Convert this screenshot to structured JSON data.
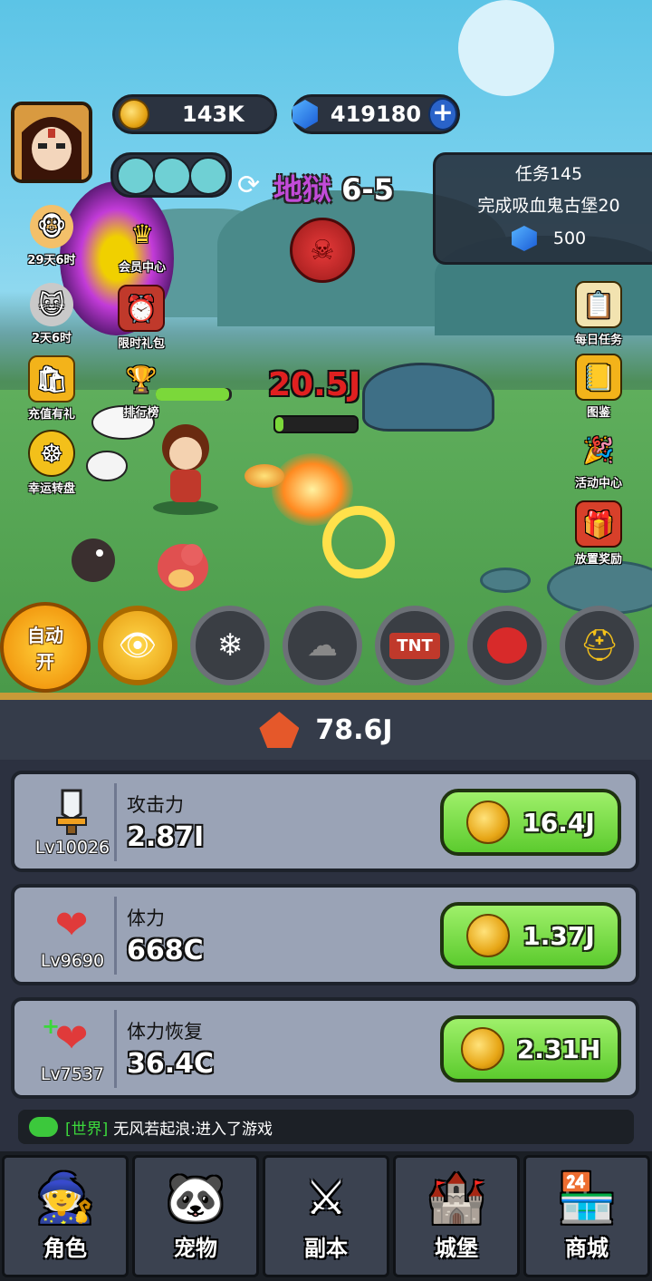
{
  "header": {
    "gold": "143K",
    "gems": "419180",
    "gem_plus": "+"
  },
  "stage": {
    "mode": "地狱",
    "level": "6-5"
  },
  "quest": {
    "title": "任务145",
    "desc": "完成吸血鬼古堡20",
    "reward": "500"
  },
  "left_menu": [
    {
      "label": "29天6时",
      "icon": "monkey-king-icon"
    },
    {
      "label": "会员中心",
      "icon": "crown-icon"
    },
    {
      "label": "2天6时",
      "icon": "cat-icon"
    },
    {
      "label": "限时礼包",
      "icon": "gift-clock-icon"
    },
    {
      "label": "充值有礼",
      "icon": "shopping-bag-icon"
    },
    {
      "label": "排行榜",
      "icon": "podium-icon"
    },
    {
      "label": "幸运转盘",
      "icon": "wheel-icon"
    }
  ],
  "right_menu": [
    {
      "label": "每日任务",
      "icon": "clipboard-icon"
    },
    {
      "label": "图鉴",
      "icon": "book-icon"
    },
    {
      "label": "活动中心",
      "icon": "party-horn-icon"
    },
    {
      "label": "放置奖励",
      "icon": "treasure-chest-icon"
    }
  ],
  "battle": {
    "damage": "20.5J"
  },
  "skills": {
    "auto_line1": "自动",
    "auto_line2": "开",
    "tnt": "TNT"
  },
  "power": {
    "value": "78.6J"
  },
  "upgrades": [
    {
      "name": "攻击力",
      "value": "2.87I",
      "level": "Lv10026",
      "cost": "16.4J",
      "icon": "sword-icon"
    },
    {
      "name": "体力",
      "value": "668C",
      "level": "Lv9690",
      "cost": "1.37J",
      "icon": "heart-icon"
    },
    {
      "name": "体力恢复",
      "value": "36.4C",
      "level": "Lv7537",
      "cost": "2.31H",
      "icon": "heart-plus-icon"
    }
  ],
  "chat": {
    "channel": "[世界]",
    "message": "无风若起浪:进入了游戏"
  },
  "nav": [
    {
      "label": "角色",
      "icon": "hero-icon"
    },
    {
      "label": "宠物",
      "icon": "panda-icon"
    },
    {
      "label": "副本",
      "icon": "crossed-swords-icon"
    },
    {
      "label": "城堡",
      "icon": "castle-icon"
    },
    {
      "label": "商城",
      "icon": "shop-icon"
    }
  ],
  "colors": {
    "hell": "#c24bd8",
    "upgrade_green": "#5ccb2e",
    "gold": "#e7a616",
    "damage": "#e02020"
  }
}
